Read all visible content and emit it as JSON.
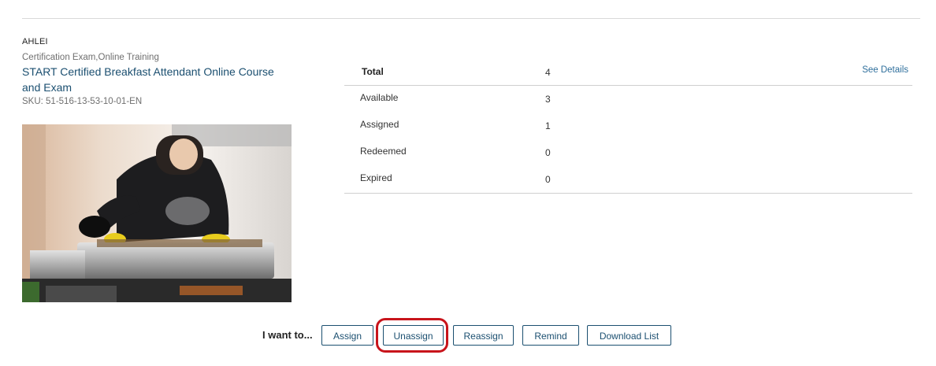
{
  "product": {
    "vendor": "AHLEI",
    "categories": "Certification Exam,Online Training",
    "title": "START Certified Breakfast Attendant Online Course and Exam",
    "sku": "SKU: 51-516-13-53-10-01-EN",
    "image_description": "photo-chef-serving-buffet"
  },
  "stats": {
    "header": {
      "label": "Total",
      "value": "4",
      "link": "See Details"
    },
    "rows": [
      {
        "label": "Available",
        "value": "3"
      },
      {
        "label": "Assigned",
        "value": "1"
      },
      {
        "label": "Redeemed",
        "value": "0"
      },
      {
        "label": "Expired",
        "value": "0"
      }
    ]
  },
  "actions": {
    "label": "I want to...",
    "buttons": [
      "Assign",
      "Unassign",
      "Reassign",
      "Remind",
      "Download List"
    ],
    "highlighted": "Unassign"
  },
  "colors": {
    "accent": "#1b4f70",
    "link": "#2f6f9c",
    "highlight": "#c8141b"
  }
}
